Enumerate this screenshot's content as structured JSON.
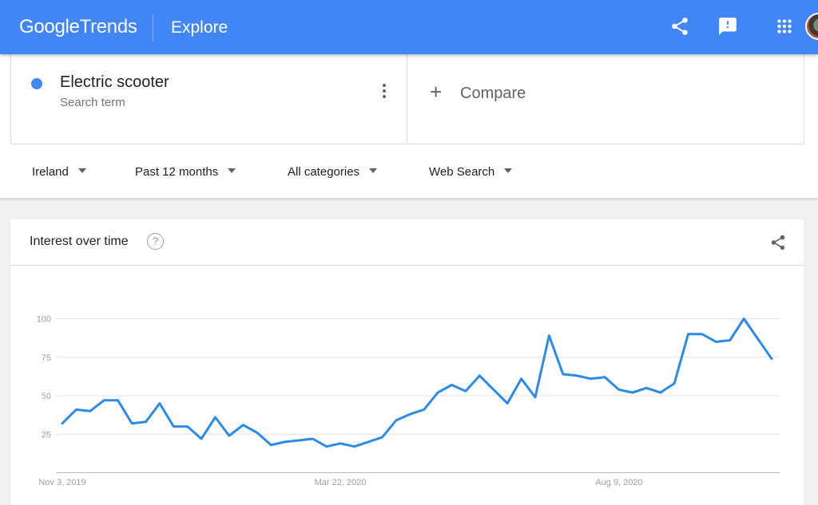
{
  "header": {
    "logo_google": "Google",
    "logo_trends": "Trends",
    "page_title": "Explore",
    "icons": [
      "share-icon",
      "feedback-icon",
      "apps-grid-icon",
      "account-avatar"
    ],
    "color": "#4285f4"
  },
  "search_term": {
    "name": "Electric scooter",
    "subtitle": "Search term",
    "color": "#4285f4"
  },
  "compare": {
    "label": "Compare"
  },
  "filters": {
    "region": "Ireland",
    "time_range": "Past 12 months",
    "category": "All categories",
    "search_type": "Web Search"
  },
  "interest_card": {
    "title": "Interest over time",
    "help_glyph": "?"
  },
  "chart_data": {
    "type": "line",
    "ylim": [
      0,
      100
    ],
    "y_ticks": [
      25,
      50,
      75,
      100
    ],
    "x_tick_labels": [
      "Nov 3, 2019",
      "Mar 22, 2020",
      "Aug 9, 2020"
    ],
    "grid": true,
    "series": [
      {
        "color": "#2d8ae6",
        "values": [
          32,
          41,
          40,
          47,
          47,
          32,
          33,
          45,
          30,
          30,
          22,
          36,
          24,
          31,
          26,
          18,
          20,
          21,
          22,
          17,
          19,
          17,
          20,
          23,
          34,
          38,
          41,
          52,
          57,
          53,
          63,
          54,
          45,
          61,
          49,
          89,
          64,
          63,
          61,
          62,
          54,
          52,
          55,
          52,
          58,
          90,
          90,
          85,
          86,
          100,
          87,
          74
        ]
      }
    ]
  }
}
